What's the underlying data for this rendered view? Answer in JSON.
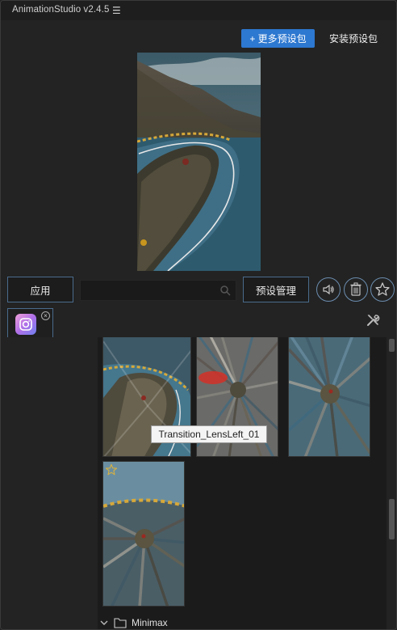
{
  "app": {
    "title": "AnimationStudio v2.4.5",
    "menu_icon": "hamburger-menu-icon"
  },
  "header": {
    "more_presets_label": "+ 更多预设包",
    "install_presets_label": "安装预设包"
  },
  "controls": {
    "apply_label": "应用",
    "search_placeholder": "",
    "search_value": "",
    "manage_label": "预设管理",
    "icons": [
      "volume-icon",
      "trash-icon",
      "star-icon"
    ]
  },
  "tabs": [
    {
      "icon": "instagram-icon",
      "close_icon": "close-icon"
    }
  ],
  "tooltip": {
    "text": "Transition_LensLeft_01"
  },
  "folder": {
    "name": "Minimax",
    "icons": [
      "chevron-down-icon",
      "folder-icon"
    ]
  },
  "colors": {
    "accent": "#2d78d0",
    "border_accent": "#4a6b8c",
    "background": "#232323"
  }
}
